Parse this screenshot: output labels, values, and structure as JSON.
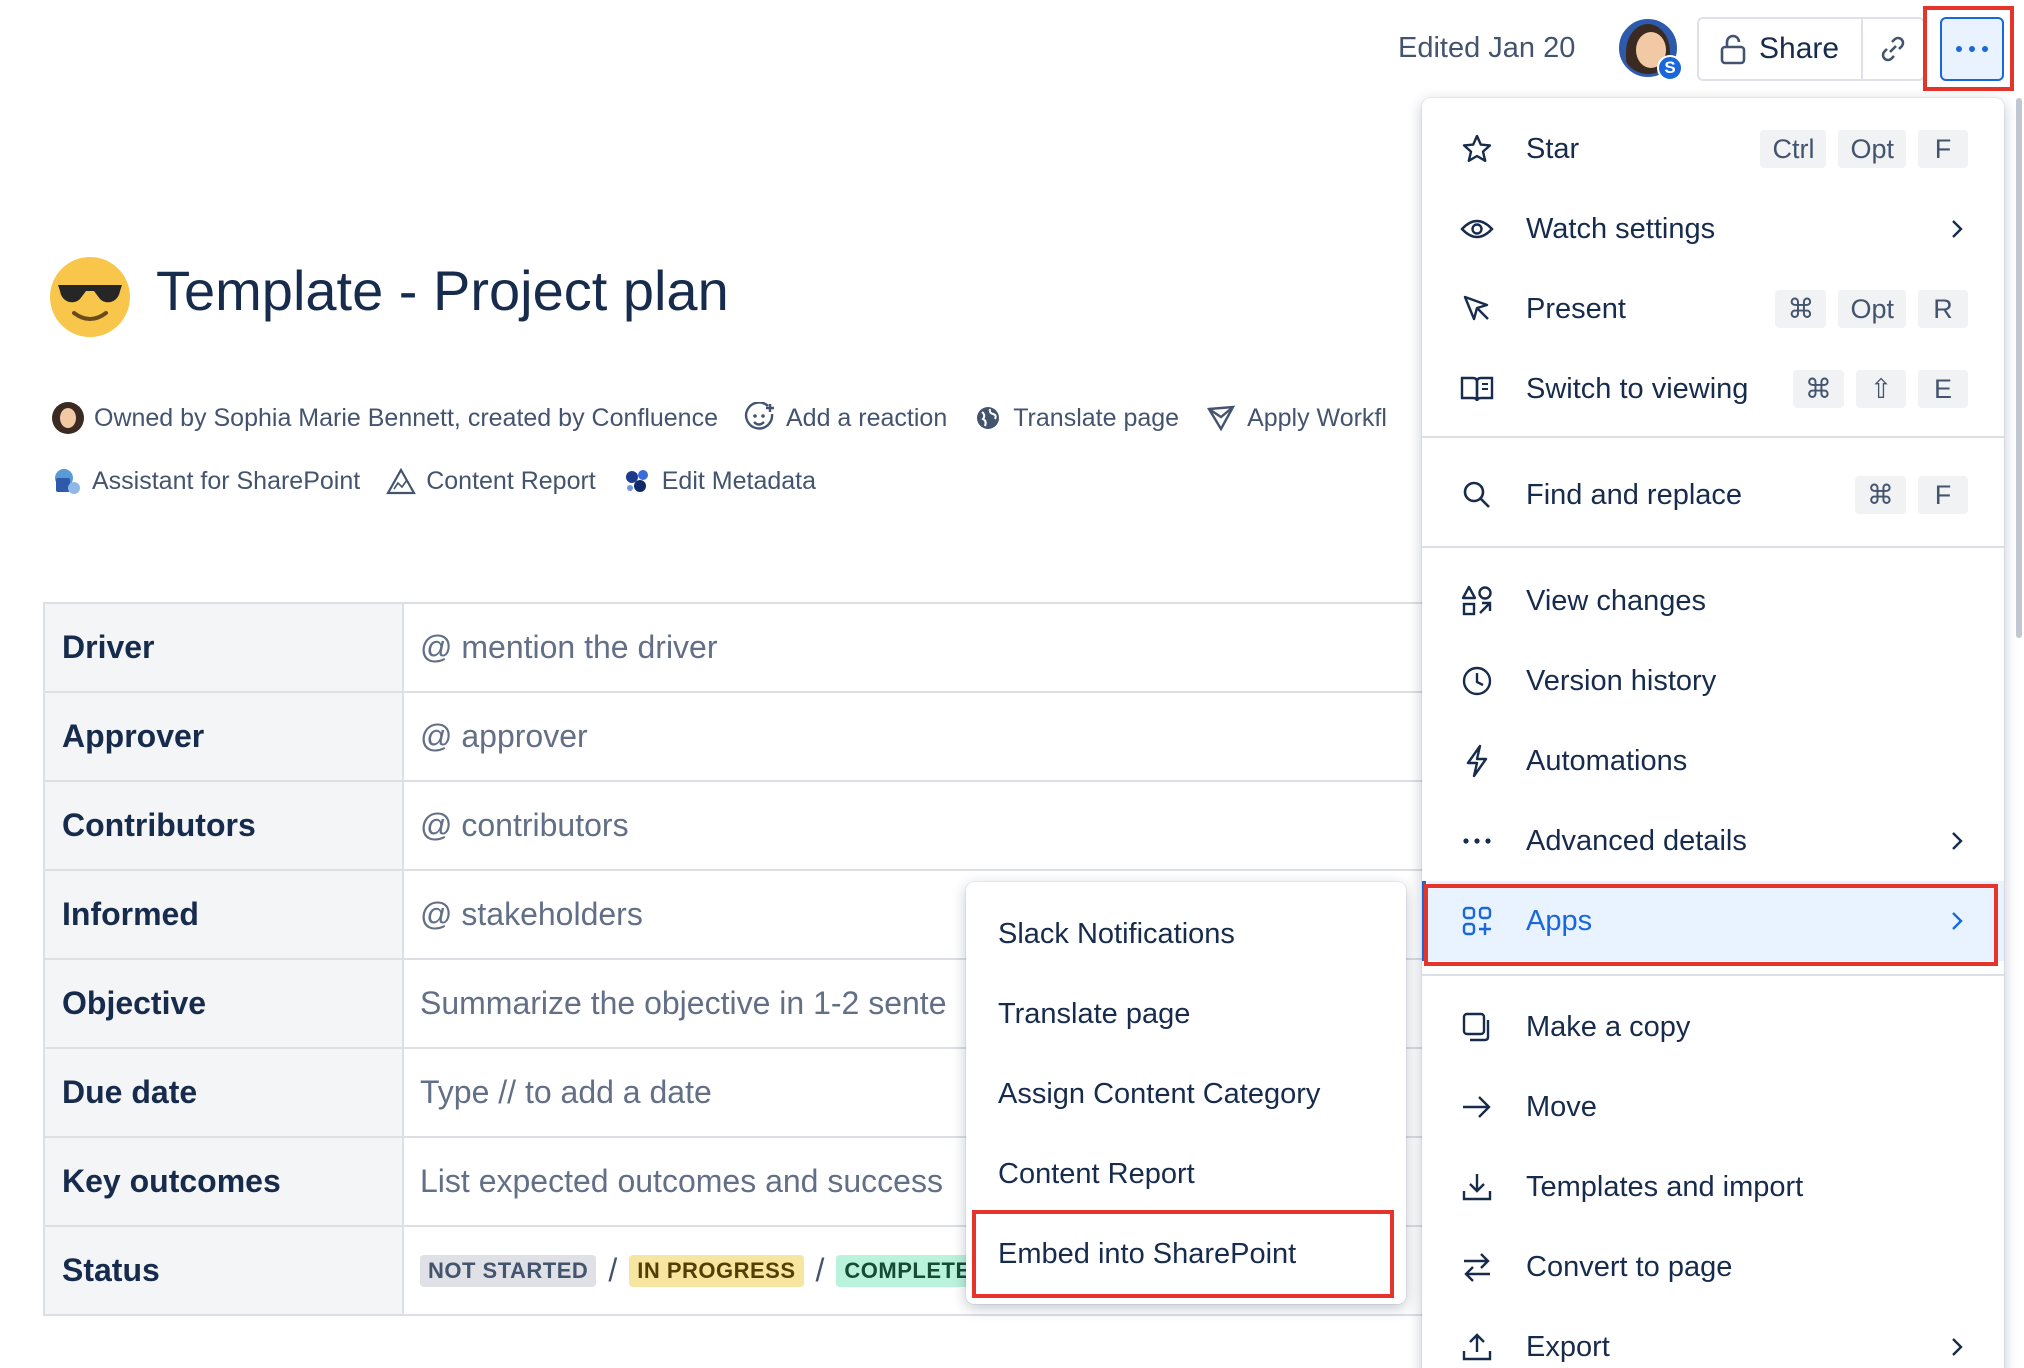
{
  "header": {
    "edited": "Edited Jan 20",
    "avatar_badge": "S",
    "share_label": "Share",
    "icons": {
      "share": "unlock-icon",
      "link": "link-icon",
      "more": "more-icon"
    }
  },
  "page": {
    "emoji": "smiling-face-with-sunglasses",
    "title": "Template - Project plan",
    "meta_row1": [
      {
        "label": "Owned by Sophia Marie Bennett, created by Confluence",
        "icon": "avatar"
      },
      {
        "label": "Add a reaction",
        "icon": "add-reaction-icon"
      },
      {
        "label": "Translate page",
        "icon": "globe-icon"
      },
      {
        "label": "Apply Workfl",
        "icon": "workflow-icon"
      }
    ],
    "meta_row2": [
      {
        "label": "Assistant for SharePoint",
        "icon": "sharepoint-icon"
      },
      {
        "label": "Content Report",
        "icon": "warning-icon"
      },
      {
        "label": "Edit Metadata",
        "icon": "metadata-icon"
      }
    ]
  },
  "table": {
    "rows": [
      {
        "key": "Driver",
        "value": "@ mention the driver"
      },
      {
        "key": "Approver",
        "value": "@ approver"
      },
      {
        "key": "Contributors",
        "value": "@ contributors"
      },
      {
        "key": "Informed",
        "value": "@ stakeholders"
      },
      {
        "key": "Objective",
        "value": "Summarize the objective in 1-2 sente"
      },
      {
        "key": "Due date",
        "value": "Type // to add a date"
      },
      {
        "key": "Key outcomes",
        "value": "List expected outcomes and success"
      },
      {
        "key": "Status",
        "value": ""
      }
    ],
    "status": {
      "not_started": "NOT STARTED",
      "in_progress": "IN PROGRESS",
      "complete": "COMPLETE",
      "separator": "/"
    }
  },
  "menu": {
    "star": {
      "label": "Star",
      "keys": [
        "Ctrl",
        "Opt",
        "F"
      ],
      "icon": "star-icon"
    },
    "watch": {
      "label": "Watch settings",
      "icon": "eye-icon"
    },
    "present": {
      "label": "Present",
      "keys": [
        "⌘",
        "Opt",
        "R"
      ],
      "icon": "present-icon"
    },
    "switch": {
      "label": "Switch to viewing",
      "keys": [
        "⌘",
        "⇧",
        "E"
      ],
      "icon": "book-icon"
    },
    "find": {
      "label": "Find and replace",
      "keys": [
        "⌘",
        "F"
      ],
      "icon": "search-icon"
    },
    "view_changes": {
      "label": "View changes",
      "icon": "shapes-icon"
    },
    "version": {
      "label": "Version history",
      "icon": "clock-icon"
    },
    "automations": {
      "label": "Automations",
      "icon": "lightning-icon"
    },
    "advanced": {
      "label": "Advanced details",
      "icon": "ellipsis-icon"
    },
    "apps": {
      "label": "Apps",
      "icon": "apps-icon"
    },
    "copy": {
      "label": "Make a copy",
      "icon": "copy-icon"
    },
    "move": {
      "label": "Move",
      "icon": "arrow-right-icon"
    },
    "templates": {
      "label": "Templates and import",
      "icon": "download-icon"
    },
    "convert": {
      "label": "Convert to page",
      "icon": "swap-icon"
    },
    "export": {
      "label": "Export",
      "icon": "upload-icon"
    }
  },
  "submenu": {
    "items": [
      "Slack Notifications",
      "Translate page",
      "Assign Content Category",
      "Content Report",
      "Embed into SharePoint"
    ]
  },
  "colors": {
    "accent": "#1868db",
    "highlight": "#e5342a",
    "text": "#172b4d",
    "subtle": "#44546f"
  }
}
